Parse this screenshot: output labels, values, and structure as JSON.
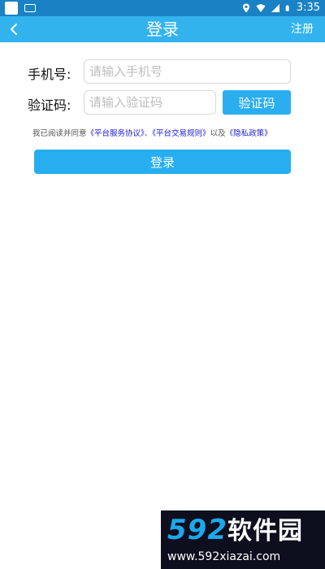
{
  "status_bar": {
    "time": "3:35",
    "icons": [
      "app-square-icon",
      "keyboard-icon",
      "location-icon",
      "wifi-icon",
      "signal-icon",
      "battery-icon"
    ]
  },
  "title_bar": {
    "title": "登录",
    "back_icon": "chevron-left-icon",
    "register_label": "注册"
  },
  "form": {
    "phone_label": "手机号:",
    "phone_placeholder": "请输入手机号",
    "phone_value": "",
    "code_label": "验证码:",
    "code_placeholder": "请输入验证码",
    "code_value": "",
    "verify_button_label": "验证码"
  },
  "agreement": {
    "prefix": "我已阅读并同意",
    "link1": "《平台服务协议》",
    "sep1": "、",
    "link2": "《平台交易规则》",
    "sep2": "以及",
    "link3": "《隐私政策》"
  },
  "login_button_label": "登录",
  "watermark": {
    "brand_digits": "592",
    "brand_cn": "软件园",
    "url": "www.592xiazai.com"
  },
  "colors": {
    "status_bar": "#1a82c4",
    "title_bar": "#33b3ee",
    "primary_button": "#27aef0",
    "link": "#1b1bd6"
  }
}
